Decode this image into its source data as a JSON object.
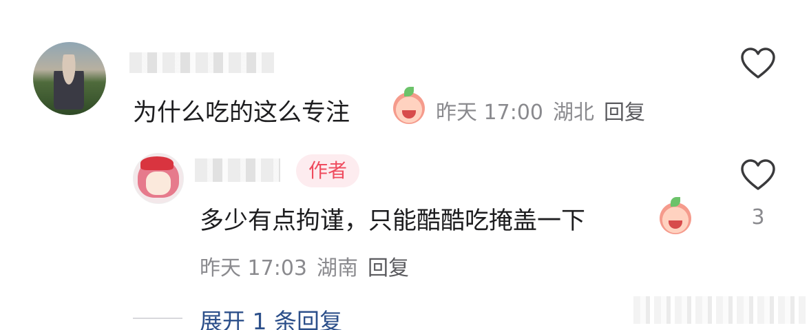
{
  "comment": {
    "text": "为什么吃的这么专注",
    "emoji": "crying-laughing-peach-emoji",
    "time": "昨天 17:00",
    "location": "湖北",
    "reply_label": "回复"
  },
  "reply": {
    "author_badge": "作者",
    "text": "多少有点拘谨，只能酷酷吃掩盖一下",
    "emoji": "eating-peach-emoji",
    "time": "昨天 17:03",
    "location": "湖南",
    "reply_label": "回复",
    "like_count": "3"
  },
  "expand": {
    "label": "展开 1 条回复"
  },
  "colors": {
    "text": "#1d1d1f",
    "meta": "#8a8a8e",
    "badge_text": "#ef4b5e",
    "badge_bg": "#fdecef",
    "link": "#2c4f8a"
  }
}
